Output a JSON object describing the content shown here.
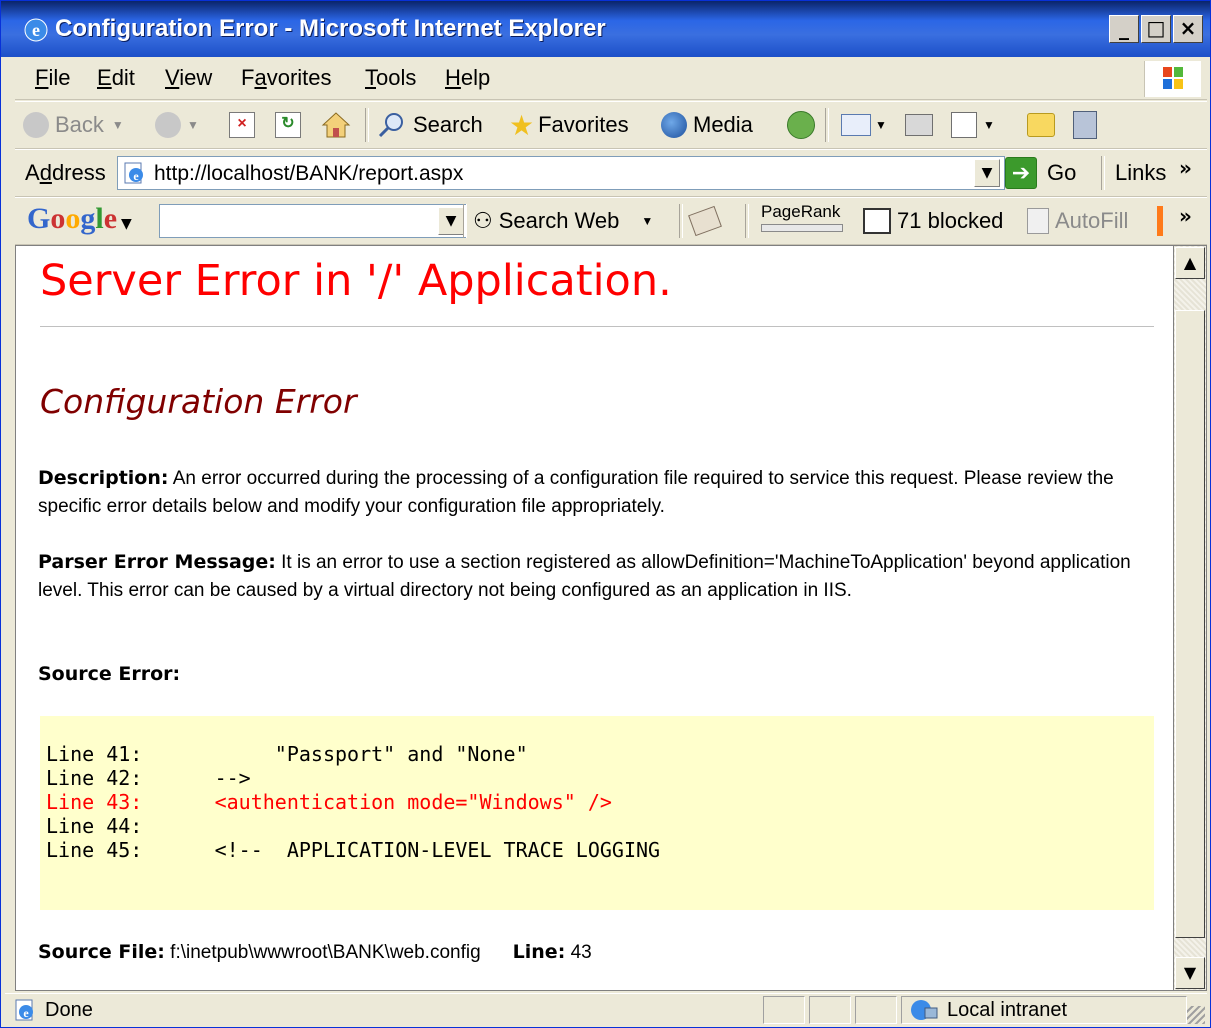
{
  "window": {
    "title": "Configuration Error - Microsoft Internet Explorer",
    "minimize": "_",
    "maximize": "□",
    "close": "×"
  },
  "menu": {
    "items": [
      {
        "underline": "F",
        "rest": "ile"
      },
      {
        "underline": "E",
        "rest": "dit"
      },
      {
        "underline": "V",
        "rest": "iew"
      },
      {
        "pre": "F",
        "underline": "a",
        "rest": "vorites"
      },
      {
        "underline": "T",
        "rest": "ools"
      },
      {
        "underline": "H",
        "rest": "elp"
      }
    ]
  },
  "toolbar": {
    "back_label": "Back",
    "search_label": "Search",
    "favorites_label": "Favorites",
    "media_label": "Media"
  },
  "address": {
    "label_pre": "A",
    "label_ul": "d",
    "label_rest": "dress",
    "url": "http://localhost/BANK/report.aspx",
    "go_label": "Go",
    "links_label": "Links"
  },
  "google_bar": {
    "logo": "Google",
    "search_value": "",
    "search_web_label": "Search Web",
    "pagerank_label": "PageRank",
    "blocked_label": "71 blocked",
    "autofill_label": "AutoFill"
  },
  "page": {
    "heading": "Server Error in '/' Application.",
    "subheading": "Configuration Error",
    "description_label": "Description:",
    "description_text": " An error occurred during the processing of a configuration file required to service this request. Please review the specific error details below and modify your configuration file appropriately.",
    "parser_label": "Parser Error Message:",
    "parser_text": " It is an error to use a section registered as allowDefinition='MachineToApplication' beyond application level. This error can be caused by a virtual directory not being configured as an application in IIS.",
    "source_error_label": "Source Error:",
    "code_lines": [
      {
        "text": "Line 41:           \"Passport\" and \"None\"",
        "error": false
      },
      {
        "text": "Line 42:      -->",
        "error": false
      },
      {
        "text": "Line 43:      <authentication mode=\"Windows\" />",
        "error": true
      },
      {
        "text": "Line 44:",
        "error": false
      },
      {
        "text": "Line 45:      <!--  APPLICATION-LEVEL TRACE LOGGING",
        "error": false
      }
    ],
    "source_file_label": "Source File:",
    "source_file_value": " f:\\inetpub\\wwwroot\\BANK\\web.config",
    "line_label": "Line:",
    "line_value": " 43"
  },
  "status": {
    "text": "Done",
    "zone": "Local intranet"
  }
}
